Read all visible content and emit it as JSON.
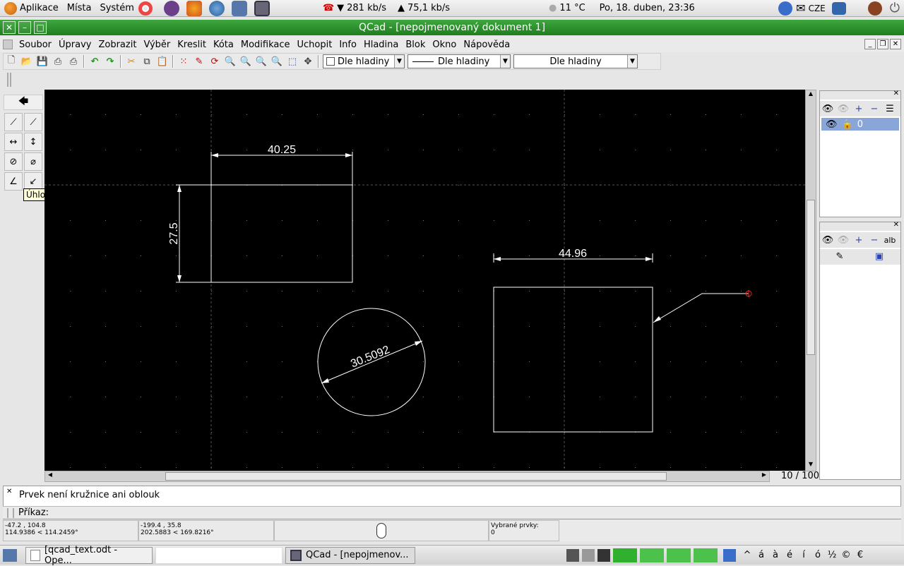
{
  "top_panel": {
    "menus": [
      "Aplikace",
      "Místa",
      "Systém"
    ],
    "net_down": "281 kb/s",
    "net_up": "75,1 kb/s",
    "weather": "11 °C",
    "datetime": "Po, 18. duben, 23:36",
    "keyboard": "CZE"
  },
  "window": {
    "title": "QCad - [nepojmenovaný dokument 1]"
  },
  "menubar": {
    "items": [
      "Soubor",
      "Úpravy",
      "Zobrazit",
      "Výběr",
      "Kreslit",
      "Kóta",
      "Modifikace",
      "Uchopit",
      "Info",
      "Hladina",
      "Blok",
      "Okno",
      "Nápověda"
    ]
  },
  "toolbar": {
    "color_combo": "Dle hladiny",
    "linetype_combo": "Dle hladiny",
    "width_combo": "Dle hladiny"
  },
  "tooltip": "Úhlová kóta",
  "drawing": {
    "dim_top_rect": "40.25",
    "dim_left_rect": "27.5",
    "dim_circle": "30.5092",
    "dim_right_rect": "44.96"
  },
  "zoom_label": "10 / 100",
  "layers": {
    "layer_name": "0"
  },
  "block_text": "alb",
  "command": {
    "message": "Prvek není kružnice ani oblouk",
    "prompt_label": "Příkaz:"
  },
  "status": {
    "abs_xy": "-47.2 , 104.8",
    "abs_polar": "114.9386 < 114.2459°",
    "rel_xy": "-199.4 , 35.8",
    "rel_polar": "202.5883 < 169.8216°",
    "selected_label": "Vybrané prvky:",
    "selected_count": "0"
  },
  "taskbar": {
    "task1": "[qcad_text.odt - Ope...",
    "task2": "QCad - [nepojmenov...",
    "chars": [
      "á",
      "à",
      "é",
      "í",
      "ó",
      "½",
      "©",
      "€"
    ]
  },
  "colors": {
    "title_green": "#2d9a2d",
    "canvas_bg": "#000000",
    "tooltip_bg": "#ffffdc"
  }
}
